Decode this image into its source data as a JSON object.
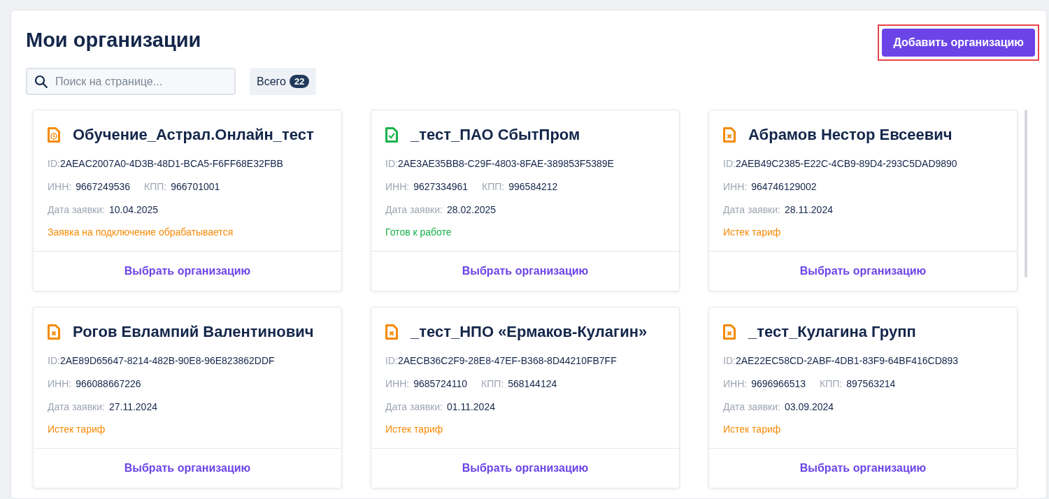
{
  "page": {
    "title": "Мои организации"
  },
  "add_button": {
    "label": "Добавить организацию",
    "highlighted": true
  },
  "search": {
    "placeholder": "Поиск на странице..."
  },
  "total": {
    "label": "Всего",
    "count": "22"
  },
  "cards": [
    {
      "name": "Обучение_Астрал.Онлайн_тест",
      "kind": "pending",
      "id_label": "ID:",
      "id": "2AEAC2007A0-4D3B-48D1-BCA5-F6FF68E32FBB",
      "inn_label": "ИНН:",
      "inn": "9667249536",
      "kpp_label": "КПП:",
      "kpp": "966701001",
      "date_label": "Дата заявки:",
      "date": "10.04.2025",
      "status": "Заявка на подключение обрабатывается",
      "action": "Выбрать организацию"
    },
    {
      "name": "_тест_ПАО СбытПром",
      "kind": "ready",
      "id_label": "ID:",
      "id": "2AE3AE35BB8-C29F-4803-8FAE-389853F5389E",
      "inn_label": "ИНН:",
      "inn": "9627334961",
      "kpp_label": "КПП:",
      "kpp": "996584212",
      "date_label": "Дата заявки:",
      "date": "28.02.2025",
      "status": "Готов к работе",
      "action": "Выбрать организацию"
    },
    {
      "name": "Абрамов Нестор Евсеевич",
      "kind": "expired",
      "id_label": "ID:",
      "id": "2AEB49C2385-E22C-4CB9-89D4-293C5DAD9890",
      "inn_label": "ИНН:",
      "inn": "964746129002",
      "date_label": "Дата заявки:",
      "date": "28.11.2024",
      "status": "Истек тариф",
      "action": "Выбрать организацию"
    },
    {
      "name": "Рогов Евлампий Валентинович",
      "kind": "expired",
      "id_label": "ID:",
      "id": "2AE89D65647-8214-482B-90E8-96E823862DDF",
      "inn_label": "ИНН:",
      "inn": "966088667226",
      "date_label": "Дата заявки:",
      "date": "27.11.2024",
      "status": "Истек тариф",
      "action": "Выбрать организацию"
    },
    {
      "name": "_тест_НПО «Ермаков-Кулагин»",
      "kind": "expired",
      "id_label": "ID:",
      "id": "2AECB36C2F9-28E8-47EF-B368-8D44210FB7FF",
      "inn_label": "ИНН:",
      "inn": "9685724110",
      "kpp_label": "КПП:",
      "kpp": "568144124",
      "date_label": "Дата заявки:",
      "date": "01.11.2024",
      "status": "Истек тариф",
      "action": "Выбрать организацию"
    },
    {
      "name": "_тест_Кулагина Групп",
      "kind": "expired",
      "id_label": "ID:",
      "id": "2AE22EC58CD-2ABF-4DB1-83F9-64BF416CD893",
      "inn_label": "ИНН:",
      "inn": "9696966513",
      "kpp_label": "КПП:",
      "kpp": "897563214",
      "date_label": "Дата заявки:",
      "date": "03.09.2024",
      "status": "Истек тариф",
      "action": "Выбрать организацию"
    }
  ]
}
